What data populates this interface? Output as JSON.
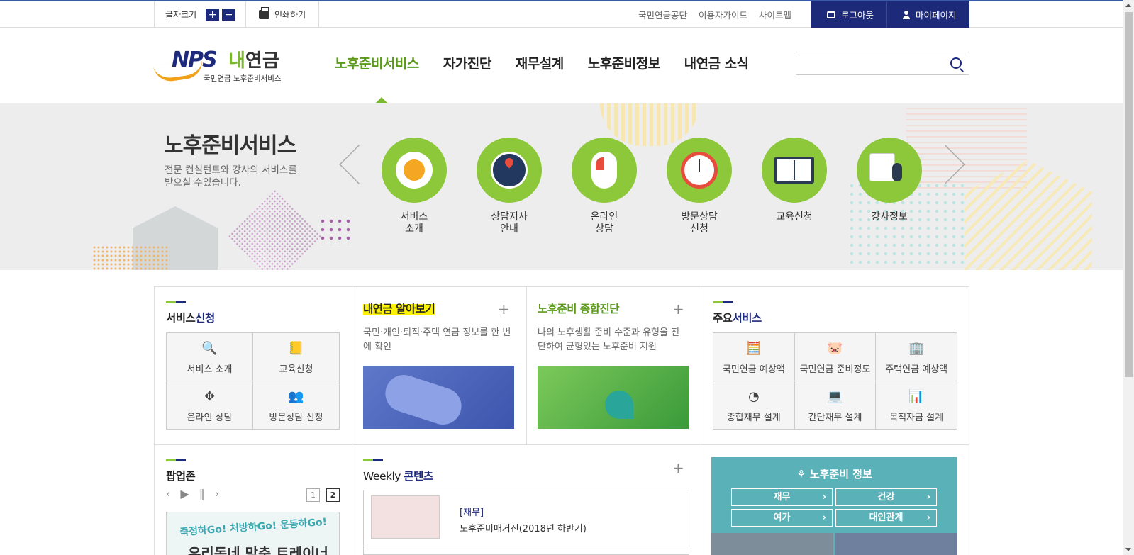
{
  "util": {
    "font_size_label": "글자크기",
    "plus": "+",
    "minus": "−",
    "print_label": "인쇄하기",
    "links": [
      "국민연금공단",
      "이용자가이드",
      "사이트맵"
    ],
    "logout": "로그아웃",
    "mypage": "마이페이지"
  },
  "logo": {
    "nps": "NPS",
    "brand": "내연금",
    "brand_prefix": "내",
    "brand_suffix": "연금",
    "sub": "국민연금 노후준비서비스"
  },
  "gnb": [
    "노후준비서비스",
    "자가진단",
    "재무설계",
    "노후준비정보",
    "내연금 소식"
  ],
  "search": {
    "placeholder": ""
  },
  "visual": {
    "title": "노후준비서비스",
    "desc": "전문 컨설턴트와 강사의 서비스를 받으실 수있습니다.",
    "services": [
      {
        "line1": "서비스",
        "line2": "소개",
        "icon": "coffee-icon"
      },
      {
        "line1": "상담지사",
        "line2": "안내",
        "icon": "globe-pin-icon"
      },
      {
        "line1": "온라인",
        "line2": "상담",
        "icon": "mouse-icon"
      },
      {
        "line1": "방문상담",
        "line2": "신청",
        "icon": "clock-icon"
      },
      {
        "line1": "교육신청",
        "line2": "",
        "icon": "book-icon"
      },
      {
        "line1": "강사정보",
        "line2": "",
        "icon": "microphone-icon"
      }
    ]
  },
  "service_apply": {
    "title_a": "서비스",
    "title_b": "신청",
    "items": [
      "서비스 소개",
      "교육신청",
      "온라인 상담",
      "방문상담 신청"
    ]
  },
  "my_pension": {
    "title": "내연금 알아보기",
    "desc": "국민·개인·퇴직·주택 연금 정보를 한 번에 확인"
  },
  "diagnosis": {
    "title": "노후준비 종합진단",
    "desc": "나의 노후생활 준비 수준과 유형을 진단하여 균형있는 노후준비 지원"
  },
  "main_service": {
    "title_a": "주요",
    "title_b": "서비스",
    "items": [
      "국민연금 예상액",
      "국민연금 준비정도",
      "주택연금 예상액",
      "종합재무 설계",
      "간단재무 설계",
      "목적자금 설계"
    ]
  },
  "popup": {
    "title": "팝업존",
    "page1": "1",
    "page2": "2",
    "banner_line1": "측정하Go! 처방하Go! 운동하Go!",
    "banner_line2": "우리동네 맞춤 트레이너"
  },
  "weekly": {
    "title_a": "Weekly ",
    "title_b": "콘텐츠",
    "item_category": "[재무]",
    "item_title": "노후준비매거진(2018년 하반기)"
  },
  "info": {
    "title": "노후준비 정보",
    "buttons": [
      "재무",
      "건강",
      "여가",
      "대인관계"
    ]
  },
  "colors": {
    "navy": "#1d2a7a",
    "green": "#8dc83a",
    "teal": "#5bb1b8"
  }
}
